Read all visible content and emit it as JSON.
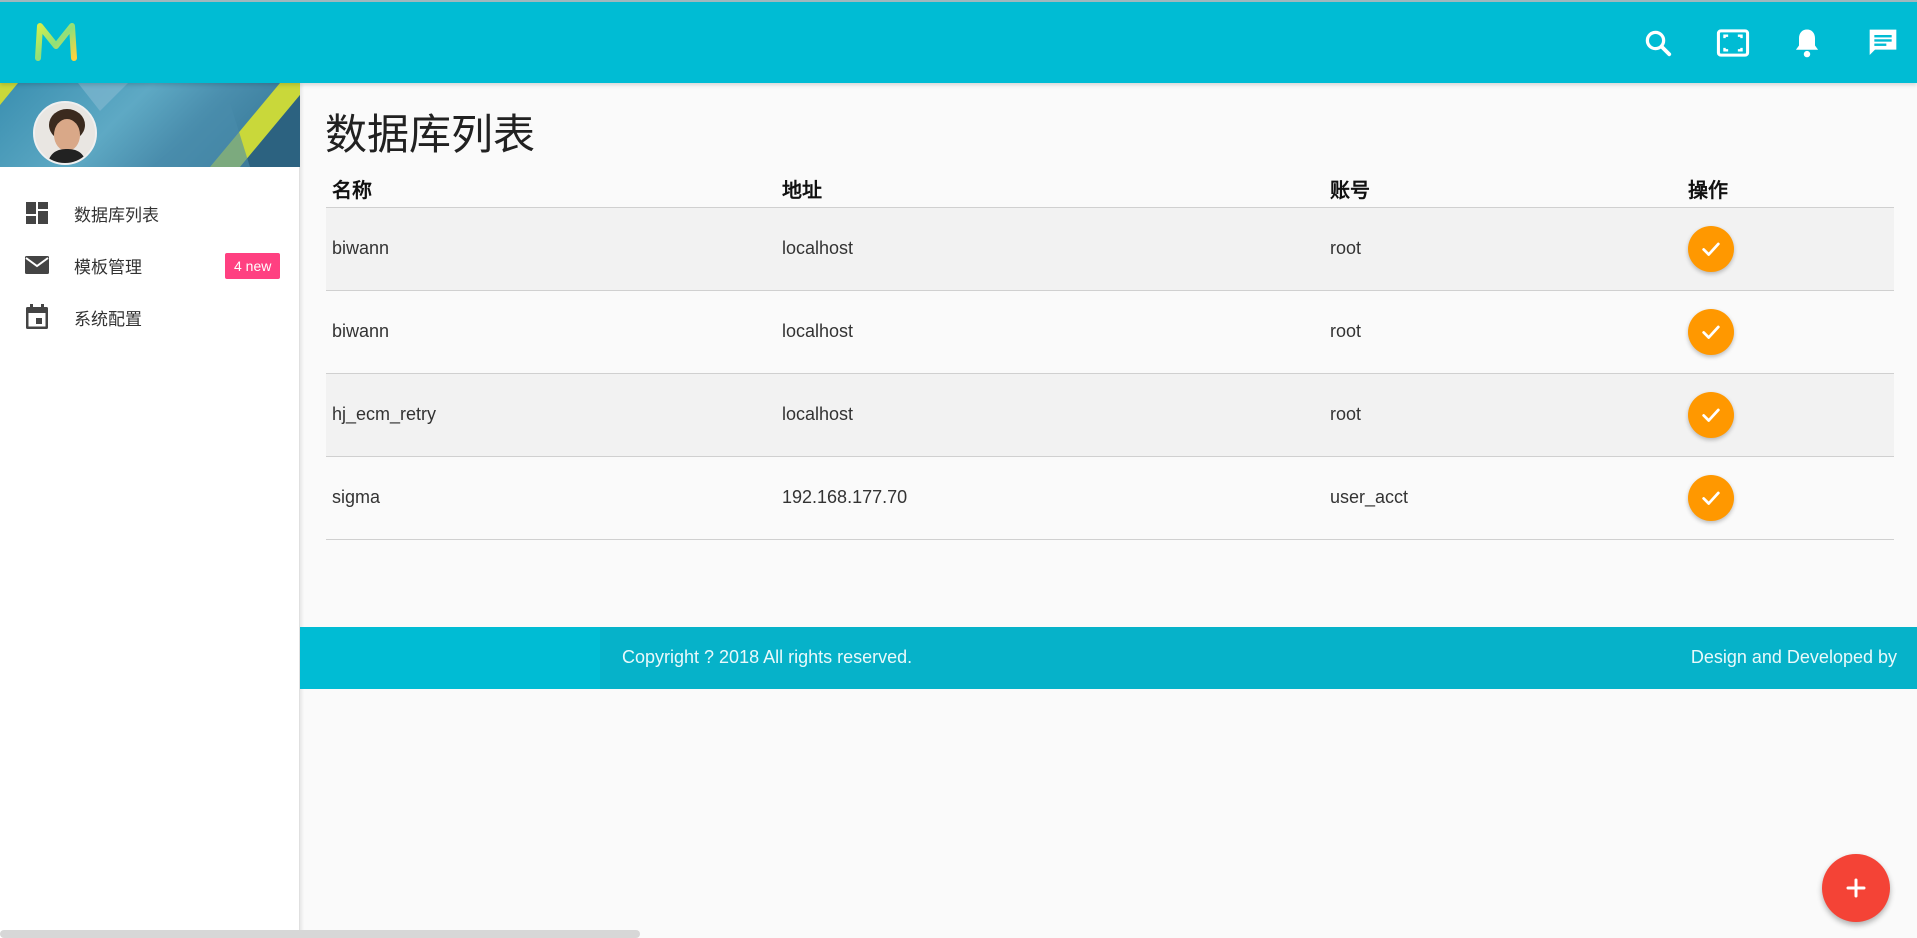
{
  "header": {
    "logo_text": "M",
    "icons": [
      "search-icon",
      "fullscreen-icon",
      "notifications-icon",
      "message-icon"
    ],
    "color": "#00bcd4"
  },
  "sidebar": {
    "items": [
      {
        "label": "数据库列表",
        "icon": "dashboard-icon"
      },
      {
        "label": "模板管理",
        "icon": "mail-icon",
        "badge": "4 new"
      },
      {
        "label": "系统配置",
        "icon": "calendar-icon"
      }
    ],
    "badge_color": "#ff4081"
  },
  "main": {
    "title": "数据库列表",
    "columns": [
      "名称",
      "地址",
      "账号",
      "操作"
    ],
    "rows": [
      {
        "name": "biwann",
        "address": "localhost",
        "account": "root"
      },
      {
        "name": "biwann",
        "address": "localhost",
        "account": "root"
      },
      {
        "name": "hj_ecm_retry",
        "address": "localhost",
        "account": "root"
      },
      {
        "name": "sigma",
        "address": "192.168.177.70",
        "account": "user_acct"
      }
    ],
    "action_color": "#ff9800"
  },
  "footer": {
    "copyright": "Copyright ? 2018 All rights reserved.",
    "design": "Design and Developed by"
  },
  "fab": {
    "icon": "add-icon",
    "color": "#f44336"
  }
}
